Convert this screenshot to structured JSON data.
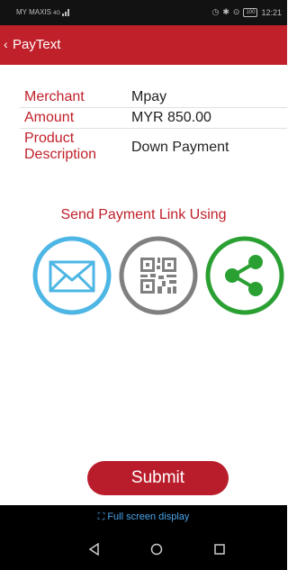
{
  "status_bar": {
    "carrier": "MY MAXIS",
    "network": "4G",
    "battery": "100",
    "time": "12:21"
  },
  "app_bar": {
    "back_icon": "chevron-left",
    "title": "PayText"
  },
  "details": [
    {
      "label": "Merchant",
      "value": "Mpay"
    },
    {
      "label": "Amount",
      "value": "MYR 850.00"
    },
    {
      "label": "Product Description",
      "value": "Down Payment"
    }
  ],
  "send_section": {
    "title": "Send Payment Link Using",
    "options": [
      {
        "icon": "email-icon",
        "color": "#4db6e5"
      },
      {
        "icon": "qr-code-icon",
        "color": "#808080"
      },
      {
        "icon": "share-icon",
        "color": "#2aa033"
      }
    ]
  },
  "submit_label": "Submit",
  "bottom_bar": {
    "fullscreen_label": "Full screen display"
  },
  "colors": {
    "primary": "#c0202a",
    "statusbar": "#121212"
  }
}
